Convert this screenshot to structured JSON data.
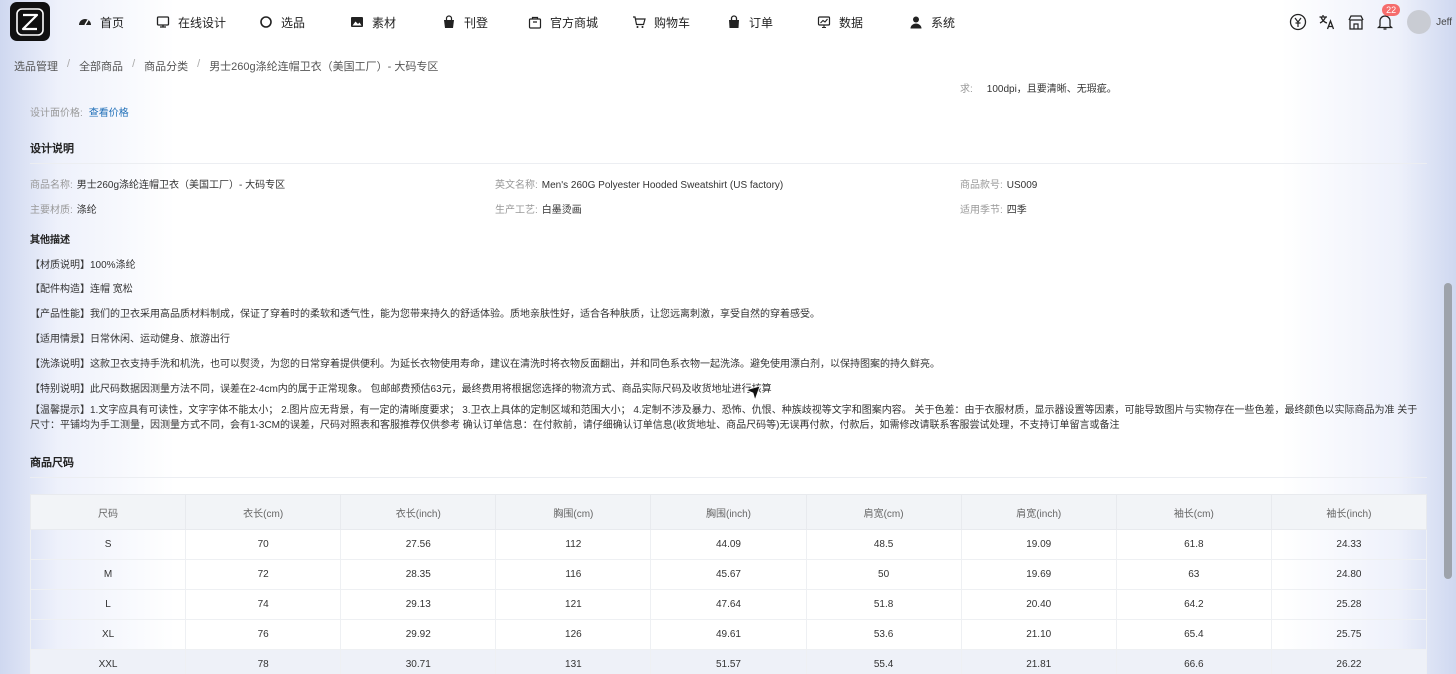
{
  "nav": {
    "items": [
      {
        "icon": "dashboard-icon",
        "label": "首页"
      },
      {
        "icon": "design-icon",
        "label": "在线设计"
      },
      {
        "icon": "circle-icon",
        "label": "选品"
      },
      {
        "icon": "image-icon",
        "label": "素材"
      },
      {
        "icon": "bag-icon",
        "label": "刊登"
      },
      {
        "icon": "store-icon",
        "label": "官方商城"
      },
      {
        "icon": "cart-icon",
        "label": "购物车"
      },
      {
        "icon": "order-bag-icon",
        "label": "订单"
      },
      {
        "icon": "chart-icon",
        "label": "数据"
      },
      {
        "icon": "user-icon",
        "label": "系统"
      }
    ],
    "notification_count": "22",
    "user_name": "Jeff"
  },
  "breadcrumb": [
    "选品管理",
    "全部商品",
    "商品分类",
    "男士260g涤纶连帽卫衣（美国工厂）- 大码专区"
  ],
  "top": {
    "req_label": "求:",
    "req_value": "100dpi，且要清晰、无瑕疵。",
    "price_label": "设计面价格:",
    "price_link": "查看价格"
  },
  "design_desc": {
    "title": "设计说明",
    "fields": [
      {
        "label": "商品名称:",
        "value": "男士260g涤纶连帽卫衣（美国工厂）- 大码专区"
      },
      {
        "label": "英文名称:",
        "value": "Men's 260G Polyester Hooded Sweatshirt (US factory)"
      },
      {
        "label": "商品款号:",
        "value": "US009"
      },
      {
        "label": "主要材质:",
        "value": "涤纶"
      },
      {
        "label": "生产工艺:",
        "value": "白墨烫画"
      },
      {
        "label": "适用季节:",
        "value": "四季"
      }
    ]
  },
  "other_desc": {
    "title": "其他描述",
    "lines": [
      "【材质说明】100%涤纶",
      "【配件构造】连帽 宽松",
      "【产品性能】我们的卫衣采用高品质材料制成，保证了穿着时的柔软和透气性，能为您带来持久的舒适体验。质地亲肤性好，适合各种肤质，让您远离刺激，享受自然的穿着感受。",
      "【适用情景】日常休闲、运动健身、旅游出行",
      "【洗涤说明】这款卫衣支持手洗和机洗，也可以熨烫，为您的日常穿着提供便利。为延长衣物使用寿命，建议在清洗时将衣物反面翻出，并和同色系衣物一起洗涤。避免使用漂白剂，以保持图案的持久鲜亮。",
      "【特别说明】此尺码数据因测量方法不同，误差在2-4cm内的属于正常现象。 包邮邮费预估63元，最终费用将根据您选择的物流方式、商品实际尺码及收货地址进行核算"
    ],
    "tip": "【温馨提示】1.文字应具有可读性，文字字体不能太小； 2.图片应无背景，有一定的清晰度要求； 3.卫衣上具体的定制区域和范围大小； 4.定制不涉及暴力、恐怖、仇恨、种族歧视等文字和图案内容。 关于色差：由于衣服材质，显示器设置等因素，可能导致图片与实物存在一些色差，最终颜色以实际商品为准 关于尺寸：平铺均为手工测量，因测量方式不同，会有1-3CM的误差，尺码对照表和客服推荐仅供参考 确认订单信息：在付款前，请仔细确认订单信息(收货地址、商品尺码等)无误再付款，付款后，如需修改请联系客服尝试处理，不支持订单留言或备注"
  },
  "size_section": {
    "title": "商品尺码",
    "headers": [
      "尺码",
      "衣长(cm)",
      "衣长(inch)",
      "胸围(cm)",
      "胸围(inch)",
      "肩宽(cm)",
      "肩宽(inch)",
      "袖长(cm)",
      "袖长(inch)"
    ],
    "rows": [
      [
        "S",
        "70",
        "27.56",
        "112",
        "44.09",
        "48.5",
        "19.09",
        "61.8",
        "24.33"
      ],
      [
        "M",
        "72",
        "28.35",
        "116",
        "45.67",
        "50",
        "19.69",
        "63",
        "24.80"
      ],
      [
        "L",
        "74",
        "29.13",
        "121",
        "47.64",
        "51.8",
        "20.40",
        "64.2",
        "25.28"
      ],
      [
        "XL",
        "76",
        "29.92",
        "126",
        "49.61",
        "53.6",
        "21.10",
        "65.4",
        "25.75"
      ],
      [
        "XXL",
        "78",
        "30.71",
        "131",
        "51.57",
        "55.4",
        "21.81",
        "66.6",
        "26.22"
      ]
    ]
  }
}
